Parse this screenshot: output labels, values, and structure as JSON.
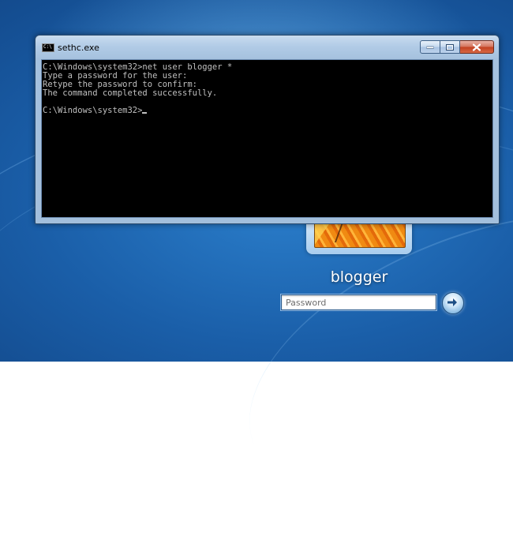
{
  "console": {
    "title": "sethc.exe",
    "icon": "console-icon",
    "icon_glyph": "C:\\",
    "lines": [
      "C:\\Windows\\system32>net user blogger *",
      "Type a password for the user:",
      "Retype the password to confirm:",
      "The command completed successfully.",
      "",
      "C:\\Windows\\system32>"
    ]
  },
  "logon": {
    "username": "blogger",
    "password_placeholder": "Password",
    "password_value": "",
    "submit_icon": "arrow-right-icon"
  },
  "colors": {
    "console_bg": "#000000",
    "console_fg": "#c0c0c0",
    "desktop_blue": "#1a5ea8"
  }
}
